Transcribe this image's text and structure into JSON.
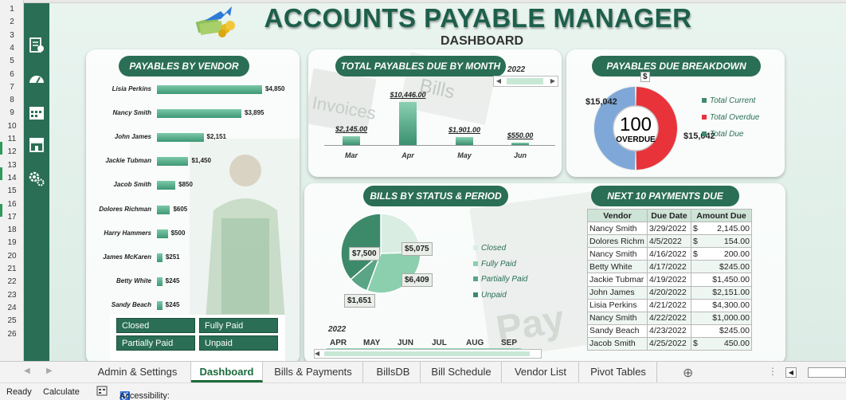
{
  "rows": [
    "1",
    "2",
    "3",
    "4",
    "5",
    "6",
    "7",
    "8",
    "9",
    "10",
    "11",
    "12",
    "13",
    "14",
    "15",
    "16",
    "17",
    "18",
    "19",
    "20",
    "21",
    "22",
    "23",
    "24",
    "25",
    "26"
  ],
  "header": {
    "title": "ACCOUNTS PAYABLE MANAGER",
    "subtitle": "DASHBOARD"
  },
  "sidebar": {
    "icons": [
      "invoice-icon",
      "gauge-icon",
      "calendar-icon",
      "store-icon",
      "gears-icon"
    ]
  },
  "vendors": {
    "title": "PAYABLES BY VENDOR",
    "items": [
      {
        "name": "Lisia Perkins",
        "label": "$4,850",
        "value": 4850
      },
      {
        "name": "Nancy Smith",
        "label": "$3,895",
        "value": 3895
      },
      {
        "name": "John James",
        "label": "$2,151",
        "value": 2151
      },
      {
        "name": "Jackie Tubman",
        "label": "$1,450",
        "value": 1450
      },
      {
        "name": "Jacob Smith",
        "label": "$850",
        "value": 850
      },
      {
        "name": "Dolores Richman",
        "label": "$605",
        "value": 605
      },
      {
        "name": "Harry Hammers",
        "label": "$500",
        "value": 500
      },
      {
        "name": "James McKaren",
        "label": "$251",
        "value": 251
      },
      {
        "name": "Betty White",
        "label": "$245",
        "value": 245
      },
      {
        "name": "Sandy Beach",
        "label": "$245",
        "value": 245
      }
    ],
    "slicer": [
      "Closed",
      "Fully Paid",
      "Partially Paid",
      "Unpaid"
    ]
  },
  "monthly": {
    "title": "TOTAL PAYABLES DUE BY MONTH",
    "year": "2022",
    "bars": [
      {
        "month": "Mar",
        "label": "$2,145.00",
        "value": 2145
      },
      {
        "month": "Apr",
        "label": "$10,446.00",
        "value": 10446
      },
      {
        "month": "May",
        "label": "$1,901.00",
        "value": 1901
      },
      {
        "month": "Jun",
        "label": "$550.00",
        "value": 550
      }
    ],
    "bg_words": [
      "Invoices",
      "Bills"
    ]
  },
  "breakdown": {
    "title": "PAYABLES DUE BREAKDOWN",
    "center_value": "100",
    "center_label": "OVERDUE",
    "label_left": "$15,042",
    "label_top": "$",
    "label_right": "$15,042",
    "current_fraction": 0.5,
    "legend": [
      "Total Current",
      "Total Overdue",
      "Total Due"
    ],
    "colors": {
      "current": "#7fa8d8",
      "overdue": "#e8333a",
      "due": "#3e8a6b"
    }
  },
  "status": {
    "title": "BILLS BY STATUS & PERIOD",
    "slices": [
      {
        "name": "Closed",
        "label": "$5,075",
        "value": 5075,
        "color": "#d9ede3"
      },
      {
        "name": "Fully Paid",
        "label": "$6,409",
        "value": 6409,
        "color": "#8ccfae"
      },
      {
        "name": "Partially Paid",
        "label": "$1,651",
        "value": 1651,
        "color": "#5aa585"
      },
      {
        "name": "Unpaid",
        "label": "$7,500",
        "value": 7500,
        "color": "#3d8a6a"
      }
    ],
    "year": "2022",
    "months": [
      "APR",
      "MAY",
      "JUN",
      "JUL",
      "AUG",
      "SEP"
    ],
    "bg_word": "Pay"
  },
  "next10": {
    "title": "NEXT 10 PAYMENTS DUE",
    "headers": [
      "Vendor",
      "Due Date",
      "Amount Due"
    ],
    "rows": [
      {
        "vendor": "Nancy Smith",
        "date": "3/29/2022",
        "sym": "$",
        "amount": "2,145.00"
      },
      {
        "vendor": "Dolores Richm",
        "date": "4/5/2022",
        "sym": "$",
        "amount": "154.00"
      },
      {
        "vendor": "Nancy Smith",
        "date": "4/16/2022",
        "sym": "$",
        "amount": "200.00"
      },
      {
        "vendor": "Betty White",
        "date": "4/17/2022",
        "sym": "",
        "amount": "$245.00"
      },
      {
        "vendor": "Jackie Tubmar",
        "date": "4/19/2022",
        "sym": "",
        "amount": "$1,450.00"
      },
      {
        "vendor": "John James",
        "date": "4/20/2022",
        "sym": "",
        "amount": "$2,151.00"
      },
      {
        "vendor": "Lisia Perkins",
        "date": "4/21/2022",
        "sym": "",
        "amount": "$4,300.00"
      },
      {
        "vendor": "Nancy Smith",
        "date": "4/22/2022",
        "sym": "",
        "amount": "$1,000.00"
      },
      {
        "vendor": "Sandy Beach",
        "date": "4/23/2022",
        "sym": "",
        "amount": "$245.00"
      },
      {
        "vendor": "Jacob Smith",
        "date": "4/25/2022",
        "sym": "$",
        "amount": "450.00"
      }
    ]
  },
  "tabs": [
    "Admin & Settings",
    "Dashboard",
    "Bills & Payments",
    "BillsDB",
    "Bill Schedule",
    "Vendor List",
    "Pivot Tables"
  ],
  "active_tab": "Dashboard",
  "status_bar": {
    "ready": "Ready",
    "calculate": "Calculate",
    "accessibility": "Accessibility: Good to go"
  },
  "chart_data": [
    {
      "type": "bar",
      "title": "PAYABLES BY VENDOR",
      "categories": [
        "Lisia Perkins",
        "Nancy Smith",
        "John James",
        "Jackie Tubman",
        "Jacob Smith",
        "Dolores Richman",
        "Harry Hammers",
        "James McKaren",
        "Betty White",
        "Sandy Beach"
      ],
      "values": [
        4850,
        3895,
        2151,
        1450,
        850,
        605,
        500,
        251,
        245,
        245
      ]
    },
    {
      "type": "bar",
      "title": "TOTAL PAYABLES DUE BY MONTH",
      "categories": [
        "Mar",
        "Apr",
        "May",
        "Jun"
      ],
      "values": [
        2145,
        10446,
        1901,
        550
      ]
    },
    {
      "type": "pie",
      "title": "PAYABLES DUE BREAKDOWN",
      "categories": [
        "Total Current",
        "Total Overdue"
      ],
      "values": [
        15042,
        15042
      ]
    },
    {
      "type": "pie",
      "title": "BILLS BY STATUS & PERIOD",
      "categories": [
        "Closed",
        "Fully Paid",
        "Partially Paid",
        "Unpaid"
      ],
      "values": [
        5075,
        6409,
        1651,
        7500
      ]
    }
  ]
}
